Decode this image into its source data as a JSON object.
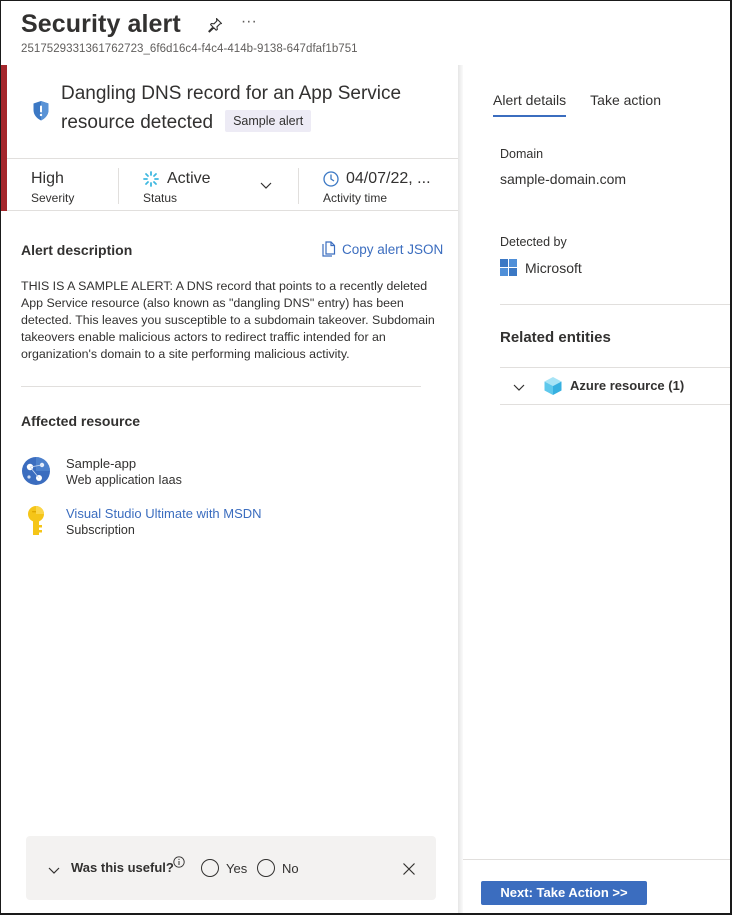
{
  "header": {
    "title": "Security alert",
    "alert_id": "2517529331361762723_6f6d16c4-f4c4-414b-9138-647dfaf1b751",
    "more_label": "···"
  },
  "alert": {
    "name": "Dangling DNS record for an App Service resource detected",
    "badge": "Sample alert",
    "severity_color": "#a4262c",
    "severity": {
      "value": "High",
      "label": "Severity"
    },
    "status": {
      "value": "Active",
      "label": "Status"
    },
    "activity": {
      "value": "04/07/22, ...",
      "label": "Activity time"
    }
  },
  "description": {
    "title": "Alert description",
    "copy_label": "Copy alert JSON",
    "text": "THIS IS A SAMPLE ALERT: A DNS record that points to a recently deleted App Service resource (also known as \"dangling DNS\" entry) has been detected. This leaves you susceptible to a subdomain takeover. Subdomain takeovers enable malicious actors to redirect traffic intended for an organization's domain to a site performing malicious activity."
  },
  "affected": {
    "title": "Affected resource",
    "items": [
      {
        "name": "Sample-app",
        "type": "Web application Iaas",
        "icon": "web-app-icon"
      },
      {
        "name": "Visual Studio Ultimate with MSDN",
        "type": "Subscription",
        "icon": "key-icon"
      }
    ]
  },
  "feedback": {
    "question": "Was this useful?",
    "yes": "Yes",
    "no": "No"
  },
  "details": {
    "tabs": [
      {
        "label": "Alert details",
        "active": true
      },
      {
        "label": "Take action",
        "active": false
      }
    ],
    "domain_label": "Domain",
    "domain_value": "sample-domain.com",
    "detected_label": "Detected by",
    "detected_value": "Microsoft",
    "related_title": "Related entities",
    "entities": [
      {
        "label": "Azure resource (1)",
        "icon": "cube-icon"
      }
    ],
    "next_button": "Next: Take Action >>"
  },
  "colors": {
    "accent": "#3b6dbf",
    "severity_high": "#a4262c",
    "badge_bg": "#edebf5"
  }
}
